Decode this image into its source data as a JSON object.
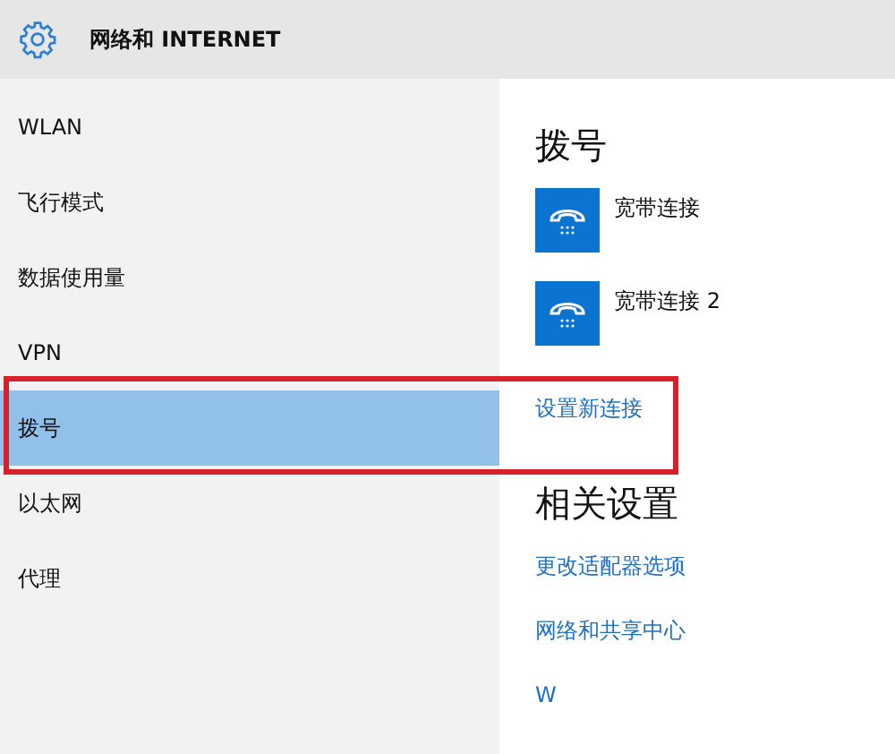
{
  "header": {
    "title": "网络和 INTERNET"
  },
  "sidebar": {
    "items": [
      {
        "label": "WLAN",
        "selected": false
      },
      {
        "label": "飞行模式",
        "selected": false
      },
      {
        "label": "数据使用量",
        "selected": false
      },
      {
        "label": "VPN",
        "selected": false
      },
      {
        "label": "拨号",
        "selected": true
      },
      {
        "label": "以太网",
        "selected": false
      },
      {
        "label": "代理",
        "selected": false
      }
    ]
  },
  "content": {
    "title": "拨号",
    "connections": [
      {
        "name": "宽带连接"
      },
      {
        "name": "宽带连接 2"
      }
    ],
    "setup_link": "设置新连接",
    "related_title": "相关设置",
    "related_links": [
      "更改适配器选项",
      "网络和共享中心",
      "W"
    ]
  },
  "annotation": {
    "kind": "highlight"
  }
}
